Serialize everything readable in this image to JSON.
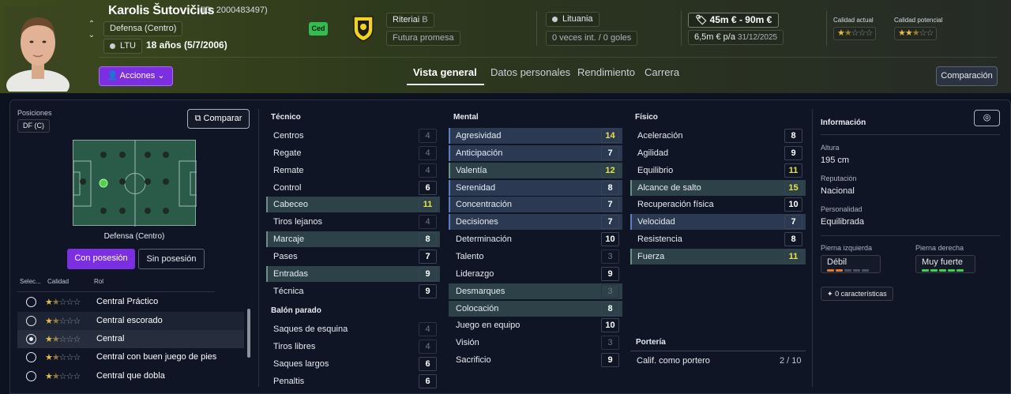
{
  "player": {
    "name": "Karolis Šutovičius",
    "id_text": "(ID: 2000483497)",
    "position": "Defensa (Centro)",
    "nation_code": "LTU",
    "age_text": "18 años (5/7/2006)",
    "status_badge": "Ced"
  },
  "club": {
    "name": "Riteriai",
    "tier": "B",
    "role": "Futura promesa"
  },
  "nation": {
    "name": "Lituania",
    "caps": "0 veces int. / 0 goles"
  },
  "contract": {
    "value_range": "45m € - 90m €",
    "wage": "6,5m € p/a",
    "expires": "31/12/2025"
  },
  "quality": {
    "current_label": "Calidad actual",
    "current_stars": 1.5,
    "potential_label": "Calidad potencial",
    "potential_stars": 2.5
  },
  "actions_label": "Acciones",
  "tabs": [
    {
      "label": "Vista general",
      "active": true
    },
    {
      "label": "Datos personales",
      "active": false
    },
    {
      "label": "Rendimiento",
      "active": false
    },
    {
      "label": "Carrera",
      "active": false
    }
  ],
  "comparacion_label": "Comparación",
  "positions": {
    "title": "Posiciones",
    "chip": "DF (C)",
    "compare_label": "Comparar",
    "position_name": "Defensa (Centro)",
    "with_ball": "Con posesión",
    "without_ball": "Sin posesión"
  },
  "roles": {
    "headers": {
      "select": "Selec...",
      "quality": "Calidad",
      "role": "Rol"
    },
    "items": [
      {
        "name": "Central Práctico",
        "stars": 1.5,
        "selected": false
      },
      {
        "name": "Central escorado",
        "stars": 1.5,
        "selected": false
      },
      {
        "name": "Central",
        "stars": 1.5,
        "selected": true
      },
      {
        "name": "Central con buen juego de pies",
        "stars": 1.5,
        "selected": false
      },
      {
        "name": "Central que dobla",
        "stars": 1.5,
        "selected": false
      }
    ]
  },
  "tecnico": {
    "title": "Técnico",
    "items": [
      {
        "name": "Centros",
        "value": "4"
      },
      {
        "name": "Regate",
        "value": "4"
      },
      {
        "name": "Remate",
        "value": "4"
      },
      {
        "name": "Control",
        "value": "6"
      },
      {
        "name": "Cabeceo",
        "value": "11"
      },
      {
        "name": "Tiros lejanos",
        "value": "4"
      },
      {
        "name": "Marcaje",
        "value": "8"
      },
      {
        "name": "Pases",
        "value": "7"
      },
      {
        "name": "Entradas",
        "value": "9"
      },
      {
        "name": "Técnica",
        "value": "9"
      }
    ]
  },
  "balon_parado": {
    "title": "Balón parado",
    "items": [
      {
        "name": "Saques de esquina",
        "value": "4"
      },
      {
        "name": "Tiros libres",
        "value": "4"
      },
      {
        "name": "Saques largos",
        "value": "6"
      },
      {
        "name": "Penaltis",
        "value": "6"
      }
    ]
  },
  "mental": {
    "title": "Mental",
    "items": [
      {
        "name": "Agresividad",
        "value": "14"
      },
      {
        "name": "Anticipación",
        "value": "7"
      },
      {
        "name": "Valentía",
        "value": "12"
      },
      {
        "name": "Serenidad",
        "value": "8"
      },
      {
        "name": "Concentración",
        "value": "7"
      },
      {
        "name": "Decisiones",
        "value": "7"
      },
      {
        "name": "Determinación",
        "value": "10"
      },
      {
        "name": "Talento",
        "value": "3"
      },
      {
        "name": "Liderazgo",
        "value": "9"
      },
      {
        "name": "Desmarques",
        "value": "3"
      },
      {
        "name": "Colocación",
        "value": "8"
      },
      {
        "name": "Juego en equipo",
        "value": "10"
      },
      {
        "name": "Visión",
        "value": "3"
      },
      {
        "name": "Sacrificio",
        "value": "9"
      }
    ]
  },
  "fisico": {
    "title": "Físico",
    "items": [
      {
        "name": "Aceleración",
        "value": "8"
      },
      {
        "name": "Agilidad",
        "value": "9"
      },
      {
        "name": "Equilibrio",
        "value": "11"
      },
      {
        "name": "Alcance de salto",
        "value": "15"
      },
      {
        "name": "Recuperación física",
        "value": "10"
      },
      {
        "name": "Velocidad",
        "value": "7"
      },
      {
        "name": "Resistencia",
        "value": "8"
      },
      {
        "name": "Fuerza",
        "value": "11"
      }
    ]
  },
  "porteria": {
    "title": "Portería",
    "label": "Calif. como portero",
    "value": "2 / 10"
  },
  "info": {
    "title": "Información",
    "height_label": "Altura",
    "height": "195 cm",
    "reputation_label": "Reputación",
    "reputation": "Nacional",
    "personality_label": "Personalidad",
    "personality": "Equilibrada",
    "left_foot_label": "Pierna izquierda",
    "left_foot": "Débil",
    "left_foot_level": 2,
    "right_foot_label": "Pierna derecha",
    "right_foot": "Muy fuerte",
    "right_foot_level": 5,
    "traits": "0 características"
  },
  "colors": {
    "accent_purple": "#7b2fe0",
    "highlight_yellow": "#e9e14b",
    "star": "#e6b94b",
    "left_foot": "#e2792c",
    "right_foot": "#3ad24f"
  }
}
